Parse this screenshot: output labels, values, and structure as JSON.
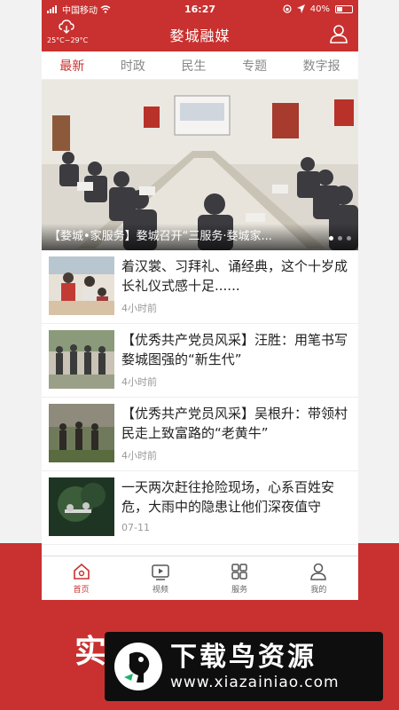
{
  "statusbar": {
    "carrier": "中国移动",
    "time": "16:27",
    "battery": "40%",
    "battery_level": 0.4
  },
  "header": {
    "title": "婺城融媒",
    "weather": "25°C~29°C"
  },
  "tabs": [
    {
      "label": "最新",
      "active": true
    },
    {
      "label": "时政",
      "active": false
    },
    {
      "label": "民生",
      "active": false
    },
    {
      "label": "专题",
      "active": false
    },
    {
      "label": "数字报",
      "active": false
    }
  ],
  "banner": {
    "caption": "【婺城•家服务】婺城召开“三服务·婺城家...",
    "slide_count": 3,
    "active_slide": 1
  },
  "news": [
    {
      "title": "着汉裳、习拜礼、诵经典，这个十岁成长礼仪式感十足......",
      "time": "4小时前"
    },
    {
      "title": "【优秀共产党员风采】汪胜：用笔书写婺城图强的“新生代”",
      "time": "4小时前"
    },
    {
      "title": "【优秀共产党员风采】吴根升：带领村民走上致富路的“老黄牛”",
      "time": "4小时前"
    },
    {
      "title": "一天两次赶往抢险现场，心系百姓安危，大雨中的隐患让他们深夜值守",
      "time": "07-11"
    }
  ],
  "nav": [
    {
      "label": "首页",
      "icon": "home-icon",
      "active": true
    },
    {
      "label": "视频",
      "icon": "video-icon",
      "active": false
    },
    {
      "label": "服务",
      "icon": "grid-icon",
      "active": false
    },
    {
      "label": "我的",
      "icon": "user-icon",
      "active": false
    }
  ],
  "promo_text": "实",
  "watermark": {
    "title": "下载鸟资源",
    "url": "www.xiazainiao.com"
  },
  "colors": {
    "accent": "#c8312f",
    "tab_inactive": "#888888",
    "time_text": "#999999"
  }
}
